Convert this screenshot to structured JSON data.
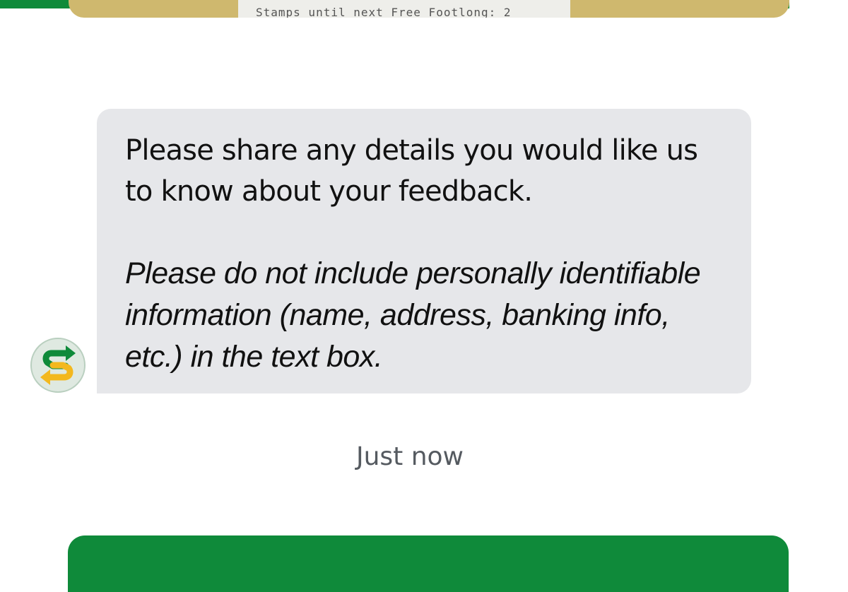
{
  "previous_card": {
    "receipt_text": "Stamps until next Free Footlong: 2"
  },
  "message": {
    "text": "Please share any details you would like us to know about your feedback.",
    "note": "Please do not include personally identifiable information (name, address, banking info, etc.) in the text box."
  },
  "timestamp": "Just now",
  "next_card": {
    "text": ""
  },
  "colors": {
    "brand_green": "#0f8a3a",
    "brand_yellow": "#f3b81e",
    "bubble_bg": "#e6e7ea"
  },
  "icons": {
    "avatar": "subway-logo-icon"
  }
}
